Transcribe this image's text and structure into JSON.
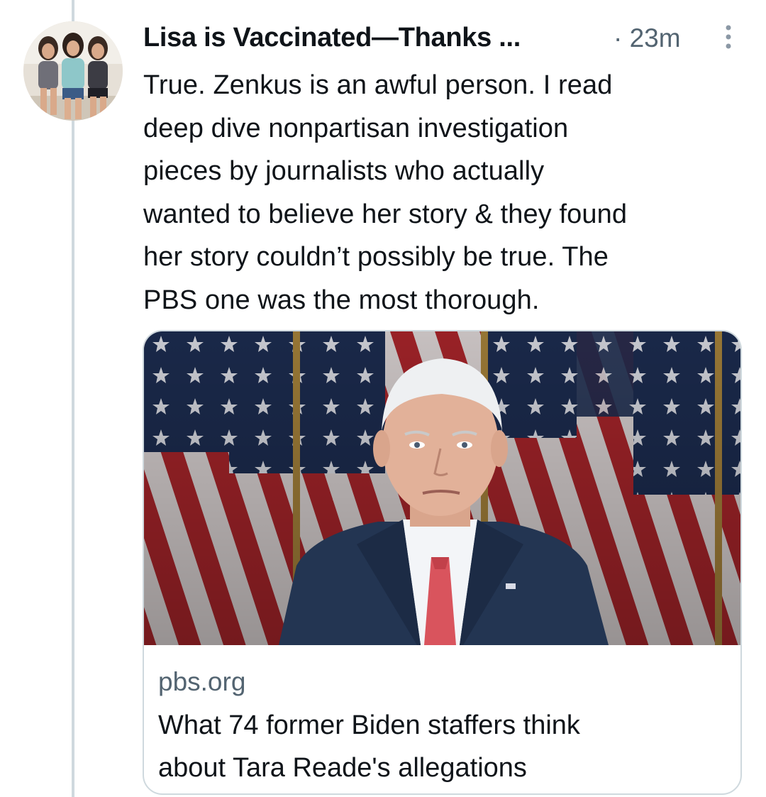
{
  "tweet": {
    "author": {
      "display_name": "Lisa is Vaccinated—Thanks ...",
      "avatar_icon": "family-photo-avatar"
    },
    "separator": "·",
    "time": "23m",
    "more_icon": "vertical-ellipsis-icon",
    "text": "True. Zenkus is an awful person. I read\ndeep dive nonpartisan investigation\npieces by journalists who actually\nwanted to believe her story & they found\nher story couldn’t possibly be true. The\nPBS one was the most thorough.",
    "link_card": {
      "image": "photo-of-man-in-suit-before-american-flags",
      "domain": "pbs.org",
      "title": "What 74 former Biden staffers think\nabout Tara Reade's allegations"
    }
  },
  "colors": {
    "text_primary": "#0f1419",
    "text_secondary": "#536471",
    "border": "#cfd9de",
    "thread_line": "#cfd9de"
  }
}
